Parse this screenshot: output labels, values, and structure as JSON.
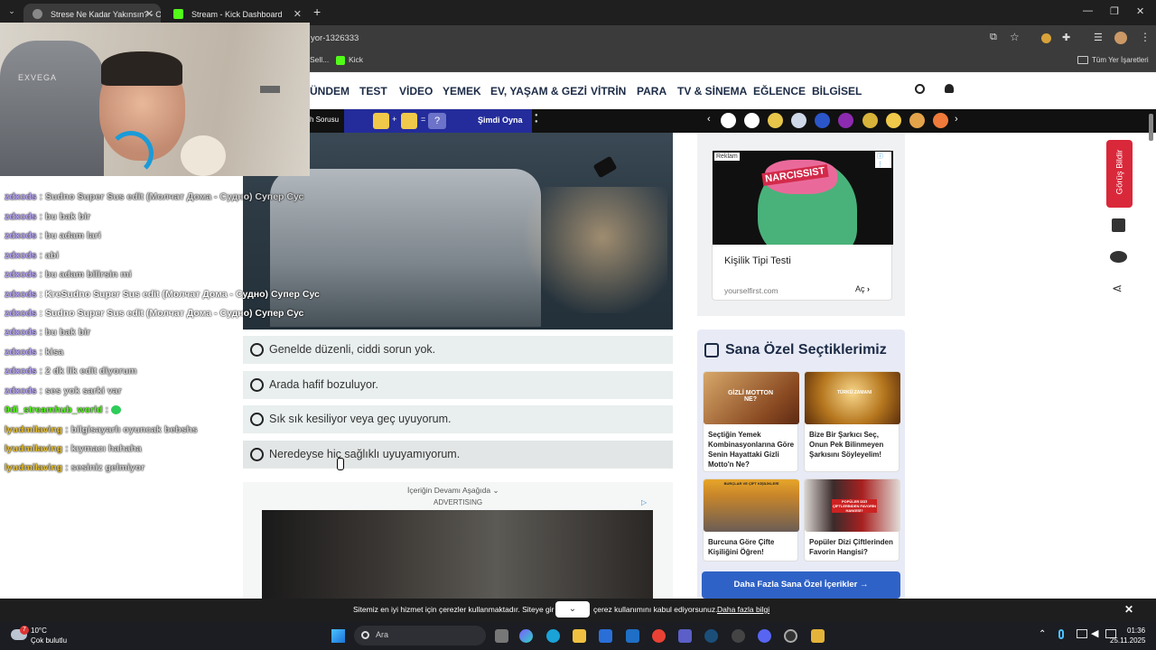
{
  "browser": {
    "tabs": [
      {
        "title": "Strese Ne Kadar Yakınsın? - One",
        "active": true
      },
      {
        "title": "Stream - Kick Dashboard",
        "active": false
      }
    ],
    "address": "yor-1326333",
    "bookmarks": [
      "Sell...",
      "Kick"
    ],
    "all_bookmarks": "Tüm Yer İşaretleri"
  },
  "site": {
    "nav": [
      "ÜNDEM",
      "TEST",
      "VİDEO",
      "YEMEK",
      "EV, YAŞAM & GEZİ",
      "VİTRİN",
      "PARA",
      "TV & SİNEMA",
      "EĞLENCE",
      "BİLGİSEL"
    ],
    "subbar_left": "h Sorusu",
    "puzzle_op1": "+",
    "puzzle_op2": "=",
    "puzzle_q": "?",
    "play_label": "Şimdi Oyna"
  },
  "quiz": {
    "options": [
      "Genelde düzenli, ciddi sorun yok.",
      "Arada hafif bozuluyor.",
      "Sık sık kesiliyor veya geç uyuyorum.",
      "Neredeyse hiç sağlıklı uyuyamıyorum."
    ],
    "continue_label": "İçeriğin Devamı Aşağıda",
    "advertising": "ADVERTISING"
  },
  "ad": {
    "badge": "Reklam",
    "image_word": "NARCISSIST",
    "title": "Kişilik Tipi Testi",
    "domain": "yourselfirst.com",
    "cta": "Aç"
  },
  "picks": {
    "heading": "Sana Özel Seçtiklerimiz",
    "items": [
      {
        "title": "Seçtiğin Yemek Kombinasyonlarına Göre Senin Hayattaki Gizli Motto'n Ne?",
        "overlay": "GİZLİ MOTTON NE?"
      },
      {
        "title": "Bize Bir Şarkıcı Seç, Onun Pek Bilinmeyen Şarkısını Söyleyelim!",
        "overlay": "TÜRKÜ ZAMANI"
      },
      {
        "title": "Burcuna Göre Çifte Kişiliğini Öğren!",
        "overlay": "BURÇLAR VE ÇİFT KİŞİLİKLERİ"
      },
      {
        "title": "Popüler Dizi Çiftlerinden Favorin Hangisi?",
        "overlay": "POPÜLER DİZİ ÇİFTLERİNDEN FAVORİN HANGİSİ?"
      }
    ],
    "more_button": "Daha Fazla Sana Özel İçerikler"
  },
  "feedback": "Görüş Bildir",
  "stream": {
    "webcam_brand": "EXVEGA",
    "chat": [
      {
        "user": "zdxcds",
        "msg": ": Sudno Super Sus edit (Молчат Дома - Судно) Супер Сус"
      },
      {
        "user": "zdxcds",
        "msg": ": bu bak bir"
      },
      {
        "user": "zdxcds",
        "msg": ": bu adam lari"
      },
      {
        "user": "zdxcds",
        "msg": ": abi"
      },
      {
        "user": "zdxcds",
        "msg": ": bu adam bilirsin mi"
      },
      {
        "user": "zdxcds",
        "msg": ": KreSudno Super Sus edit (Молчат Дома - Судно) Супер Сус"
      },
      {
        "user": "zdxcds",
        "msg": ": Sudno Super Sus edit (Молчат Дома - Судно) Супер Сус"
      },
      {
        "user": "zdxcds",
        "msg": ": bu bak bir"
      },
      {
        "user": "zdxcds",
        "msg": ": kisa"
      },
      {
        "user": "zdxcds",
        "msg": ": 2 dk lik edit diyorum"
      },
      {
        "user": "zdxcds",
        "msg": ": ses yok sarki var"
      },
      {
        "user": "0di_streamhub_world",
        "msg": ":"
      },
      {
        "user": "lyudmilaving",
        "msg": ": bilgisayarlı oyuncak bebshs"
      },
      {
        "user": "lyudmilaving",
        "msg": ": kıymacı hahaha"
      },
      {
        "user": "lyudmilaving",
        "msg": ": sesiniz gelmiyor"
      }
    ]
  },
  "cookie": {
    "text_left": "Sitemiz en iyi hizmet için çerezler kullanmaktadır. Siteye gir",
    "text_right": "çerez kullanımını kabul ediyorsunuz.",
    "link": "Daha fazla bilgi"
  },
  "taskbar": {
    "weather_temp": "10°C",
    "weather_desc": "Çok bulutlu",
    "badge": "7",
    "search": "Ara",
    "time": "01:36",
    "date": "25.11.2025"
  },
  "colors": {
    "nav_text": "#1c2b46",
    "option_bg": "#e8efee",
    "cta_blue": "#2f62c6",
    "feedback_red": "#d9283a",
    "chat_user": "#b9a3ff",
    "kick_green": "#53fc18"
  }
}
